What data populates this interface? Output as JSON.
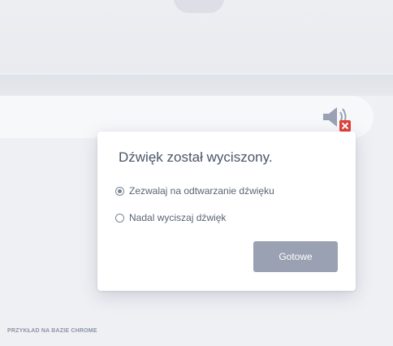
{
  "popup": {
    "title": "Dźwięk został wyciszony.",
    "options": [
      {
        "label": "Zezwalaj na odtwarzanie dźwięku",
        "selected": true
      },
      {
        "label": "Nadal wyciszaj dźwięk",
        "selected": false
      }
    ],
    "done_label": "Gotowe"
  },
  "footer": {
    "label": "PRZYKŁAD NA BAZIE CHROME"
  },
  "icons": {
    "address_bar": "muted-speaker-icon",
    "badge": "close-icon"
  },
  "colors": {
    "badge": "#e0413a",
    "button": "#9aa1b2"
  }
}
